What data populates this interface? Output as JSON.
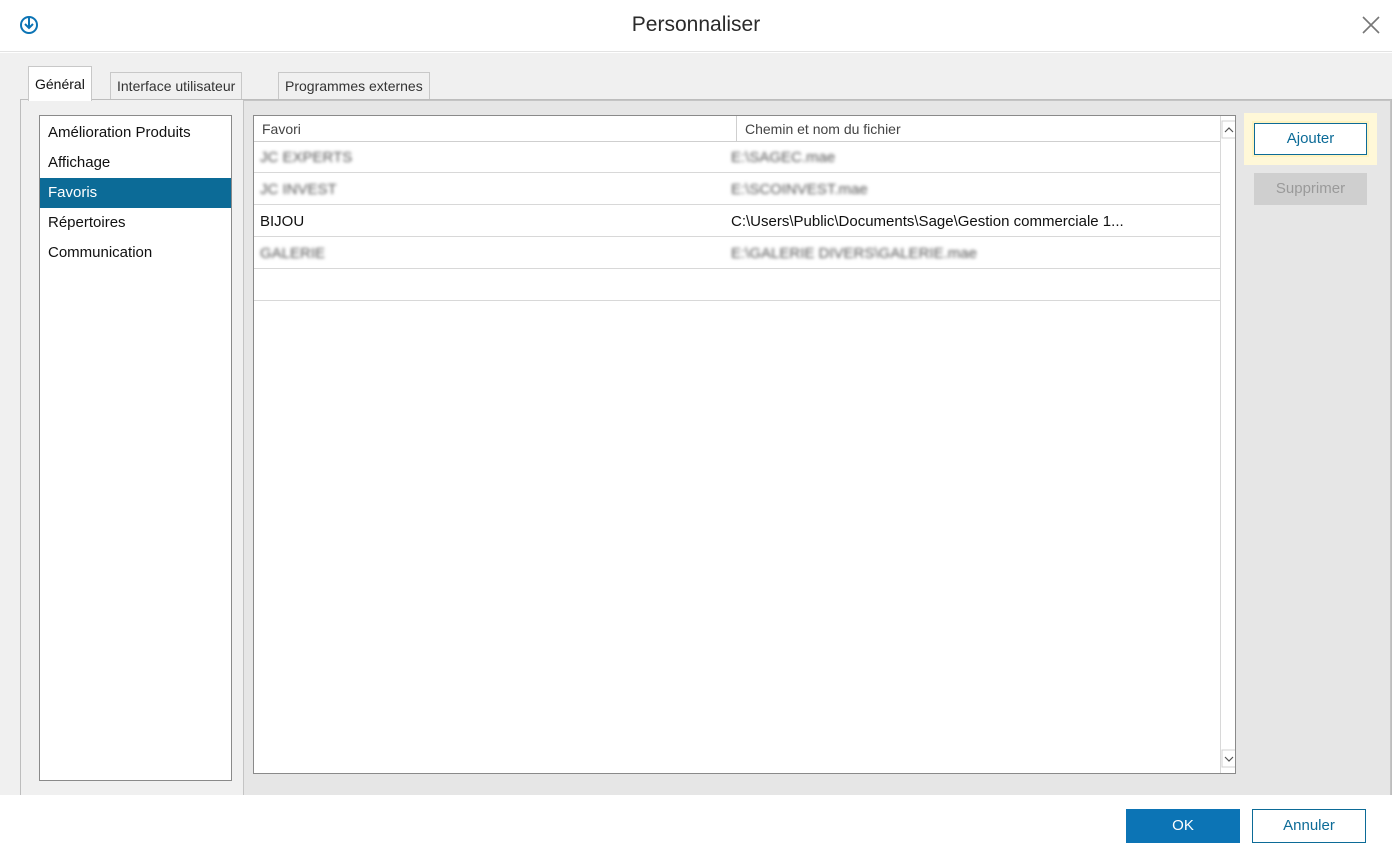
{
  "window": {
    "title": "Personnaliser"
  },
  "tabs": [
    {
      "label": "Général",
      "active": true
    },
    {
      "label": "Interface utilisateur",
      "active": false
    },
    {
      "label": "Programmes externes",
      "active": false
    }
  ],
  "sidebar": {
    "items": [
      {
        "label": "Amélioration Produits",
        "selected": false
      },
      {
        "label": "Affichage",
        "selected": false
      },
      {
        "label": "Favoris",
        "selected": true
      },
      {
        "label": "Répertoires",
        "selected": false
      },
      {
        "label": "Communication",
        "selected": false
      }
    ]
  },
  "grid": {
    "columns": [
      "Favori",
      "Chemin et nom du fichier"
    ],
    "rows": [
      {
        "favori": "JC EXPERTS",
        "chemin": "E:\\SAGEC.mae",
        "blurred": true
      },
      {
        "favori": "JC INVEST",
        "chemin": "E:\\SCOINVEST.mae",
        "blurred": true
      },
      {
        "favori": "BIJOU",
        "chemin": "C:\\Users\\Public\\Documents\\Sage\\Gestion commerciale 1...",
        "blurred": false
      },
      {
        "favori": "GALERIE",
        "chemin": "E:\\GALERIE DIVERS\\GALERIE.mae",
        "blurred": true
      }
    ]
  },
  "buttons": {
    "add": "Ajouter",
    "delete": "Supprimer",
    "ok": "OK",
    "cancel": "Annuler"
  },
  "colors": {
    "accent": "#0c6b97",
    "selection": "#0c6b97",
    "ok_button": "#0c74b5",
    "highlight": "#fff8d8"
  },
  "icons": {
    "app": "app-logo-icon",
    "close": "close-icon",
    "scroll_up": "chevron-up-icon",
    "scroll_down": "chevron-down-icon"
  }
}
